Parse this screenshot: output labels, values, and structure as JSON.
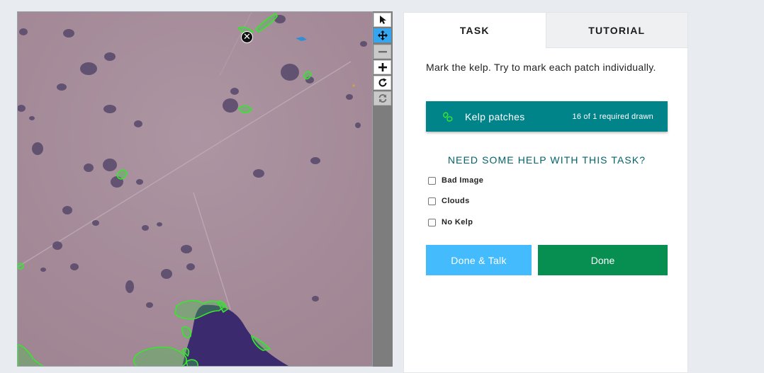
{
  "tabs": [
    {
      "label": "TASK",
      "active": true
    },
    {
      "label": "TUTORIAL",
      "active": false
    }
  ],
  "viewer": {
    "subject": "satellite-image-kelp",
    "delete_icon": "close-circle-icon",
    "marking_color": "#39e62f",
    "water_color": "#3b2a6e"
  },
  "toolbar": {
    "tools": [
      {
        "name": "pointer",
        "icon": "pointer-arrow-icon",
        "state": "normal"
      },
      {
        "name": "pan",
        "icon": "move-arrows-icon",
        "state": "active"
      },
      {
        "name": "zoom-out",
        "icon": "minus-icon",
        "state": "disabled"
      },
      {
        "name": "zoom-in",
        "icon": "plus-icon",
        "state": "normal"
      },
      {
        "name": "rotate",
        "icon": "rotate-icon",
        "state": "normal"
      },
      {
        "name": "reset",
        "icon": "reset-icon",
        "state": "disabled"
      }
    ]
  },
  "task": {
    "instruction": "Mark the kelp. Try to mark each patch individually.",
    "tool_button": {
      "label": "Kelp patches",
      "count": "16 of 1 required drawn",
      "icon": "polygon-icon",
      "color": "#00848a"
    },
    "help_heading": "NEED SOME HELP WITH THIS TASK?",
    "checkboxes": [
      {
        "label": "Bad Image",
        "checked": false
      },
      {
        "label": "Clouds",
        "checked": false
      },
      {
        "label": "No Kelp",
        "checked": false
      }
    ],
    "done_talk_label": "Done & Talk",
    "done_label": "Done",
    "done_talk_color": "#43bbfd",
    "done_color": "#078f52"
  }
}
